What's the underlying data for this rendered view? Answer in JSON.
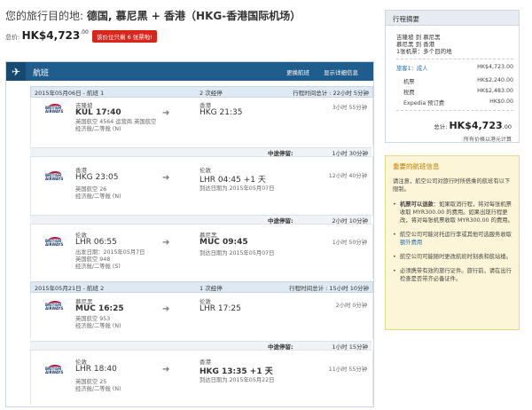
{
  "header": {
    "title_prefix": "您的旅行目的地:",
    "title_dest": "德国, 慕尼黑 + 香港（HKG-香港国际机场）",
    "total_label": "总价:",
    "total_amount": "HK$4,723",
    "total_cents": ".00",
    "badge_text": "该价位只剩 6 张票啦!"
  },
  "flights": {
    "panel_title": "航班",
    "change_flight": "更换航班",
    "show_details": "显示详细信息",
    "routes": [
      {
        "date_label": "2015年05月06日 - 航班 1",
        "stops": "2 次经停",
        "duration": "行程时间总计 : 22小时 5分钟",
        "segments": [
          {
            "airline": "BRITISH AIRWAYS",
            "from_city": "吉隆坡",
            "from_time": "KUL 17:40",
            "info1": "英国航空 4564 运营商 英国航空",
            "info2": "经济舱/二等舱 (N)",
            "to_city": "香港",
            "to_time": "HKG 21:35",
            "to_note": "",
            "duration": "3小时 55分钟"
          },
          {
            "airline": "BRITISH AIRWAYS",
            "from_city": "香港",
            "from_time": "HKG 23:05",
            "info1": "英国航空 26",
            "info2": "经济舱/二等舱 (N)",
            "to_city": "伦敦",
            "to_time": "LHR 04:45 +1 天",
            "to_note": "到达日期为 2015年05月07日",
            "duration": "12小时 40分钟"
          },
          {
            "airline": "BRITISH AIRWAYS",
            "from_city": "伦敦",
            "from_time": "LHR 06:55",
            "info1": "出发日期：2015年05月7日",
            "info2": "英国航空 948",
            "info3": "经济舱/二等舱 (S)",
            "to_city": "慕尼黑",
            "to_time": "MUC 09:45",
            "to_note": "到达日期为 2015年05月07日",
            "duration": "1小时 50分钟"
          }
        ],
        "layovers": [
          {
            "label": "中途停留:",
            "dur": "1小时 30分钟"
          },
          {
            "label": "中途停留:",
            "dur": "2小时 10分钟"
          }
        ]
      },
      {
        "date_label": "2015年05月21日 - 航班 2",
        "stops": "1 次经停",
        "duration": "行程时间总计 : 15小时 10分钟",
        "segments": [
          {
            "airline": "BRITISH AIRWAYS",
            "from_city": "慕尼黑",
            "from_time": "MUC 16:25",
            "info1": "英国航空 953",
            "info2": "经济舱/二等舱 (N)",
            "to_city": "伦敦",
            "to_time": "LHR 17:25",
            "to_note": "",
            "duration": "2小时 0分钟"
          },
          {
            "airline": "BRITISH AIRWAYS",
            "from_city": "伦敦",
            "from_time": "LHR 18:40",
            "info1": "英国航空 25",
            "info2": "经济舱/二等舱 (N)",
            "to_city": "香港",
            "to_time": "HKG 13:35 +1 天",
            "to_note": "到达日期为 2015年05月22日",
            "duration": "11小时 55分钟"
          }
        ],
        "layovers": [
          {
            "label": "中途停留:",
            "dur": "1小时 15分钟"
          }
        ]
      }
    ]
  },
  "summary": {
    "title": "行程摘要",
    "line1": "吉隆坡 到 慕尼黑",
    "line2": "慕尼黑 到 香港",
    "line3": "1张机票：多个目的地",
    "traveler": "旅客1：成人",
    "traveler_amt": "HK$4,723.00",
    "fare_label": "机票",
    "fare_amt": "HK$2,240.00",
    "tax_label": "税费",
    "tax_amt": "HK$2,483.00",
    "fee_label": "Expedia 预订费",
    "fee_amt": "HK$0.00",
    "total_label": "总计:",
    "total_amt": "HK$4,723",
    "total_cents": ".00",
    "note": "所有价格以港元计算"
  },
  "important": {
    "title": "重要的航班信息",
    "intro": "请注意，航空公司对旅行时所搭乘的航班有以下限制。",
    "b1_bold": "机票可以退款",
    "b1_text": "：如果取消行程，将对每张机票收取 MYR300.00 的费用。如果出现行程更改，将对每张机票收取 MYR300.00 的费用。",
    "b2_text": "航空公司可能对托运行李或其他可选服务收取",
    "b2_link": "额外费用",
    "b3_text": "航空公司可能随时更改航班时刻表和航站楼。",
    "b4_text": "必须携带有效的旅行证件。旅行前，请在出行检查是否带齐必备证件。"
  }
}
